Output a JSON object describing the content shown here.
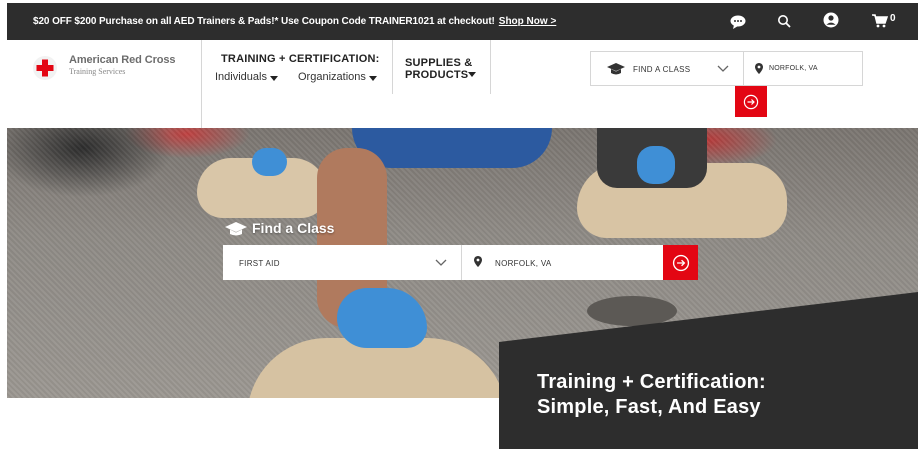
{
  "promo": {
    "text": "$20 OFF $200 Purchase on all AED Trainers & Pads!* Use Coupon Code TRAINER1021 at checkout!",
    "link": "Shop Now >"
  },
  "header_icons": {
    "chat": "chat-icon",
    "search": "search-icon",
    "account": "account-icon",
    "cart": "cart-icon",
    "cart_count": "0"
  },
  "brand": {
    "name": "American Red Cross",
    "sub": "Training Services"
  },
  "nav": {
    "training": "TRAINING + CERTIFICATION:",
    "individuals": "Individuals",
    "organizations": "Organizations",
    "supplies_line1": "SUPPLIES &",
    "supplies_line2": "PRODUCTS"
  },
  "header_search": {
    "class_label": "FIND A CLASS",
    "location": "NORFOLK, VA"
  },
  "find_class": {
    "title": "Find a Class",
    "course": "FIRST AID",
    "location": "NORFOLK, VA"
  },
  "hero": {
    "tagline_line1": "Training + Certification:",
    "tagline_line2": "Simple, Fast, And Easy"
  },
  "colors": {
    "brand_red": "#e30613",
    "dark_bar": "#2d2d2d"
  }
}
